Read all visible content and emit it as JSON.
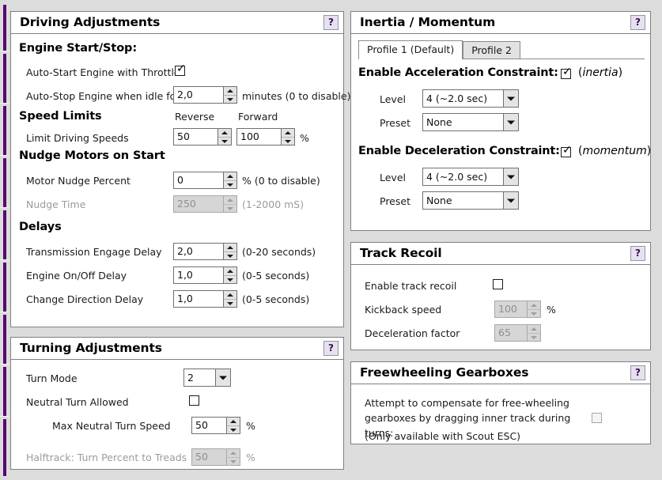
{
  "driving": {
    "title": "Driving Adjustments",
    "help": "?",
    "engine_section": "Engine Start/Stop:",
    "autostart_label": "Auto-Start Engine with Throttle",
    "autostart_checked": true,
    "autostop_label": "Auto-Stop Engine when idle for",
    "autostop_value": "2,0",
    "autostop_unit": "minutes (0 to disable)",
    "speed_section": "Speed Limits",
    "reverse_header": "Reverse",
    "forward_header": "Forward",
    "limit_label": "Limit Driving Speeds",
    "limit_reverse": "50",
    "limit_forward": "100",
    "limit_unit": "%",
    "nudge_section": "Nudge Motors on Start",
    "nudge_percent_label": "Motor Nudge Percent",
    "nudge_percent_value": "0",
    "nudge_percent_unit": "% (0 to disable)",
    "nudge_time_label": "Nudge Time",
    "nudge_time_value": "250",
    "nudge_time_unit": "(1-2000 mS)",
    "delays_section": "Delays",
    "transmission_label": "Transmission Engage Delay",
    "transmission_value": "2,0",
    "transmission_unit": "(0-20 seconds)",
    "engine_onoff_label": "Engine On/Off Delay",
    "engine_onoff_value": "1,0",
    "engine_onoff_unit": "(0-5 seconds)",
    "change_dir_label": "Change Direction Delay",
    "change_dir_value": "1,0",
    "change_dir_unit": "(0-5 seconds)"
  },
  "turning": {
    "title": "Turning Adjustments",
    "help": "?",
    "turn_mode_label": "Turn Mode",
    "turn_mode_value": "2",
    "neutral_turn_label": "Neutral Turn Allowed",
    "neutral_turn_checked": false,
    "max_neutral_label": "Max Neutral Turn Speed",
    "max_neutral_value": "50",
    "max_neutral_unit": "%",
    "halftrack_label": "Halftrack: Turn Percent to Treads",
    "halftrack_value": "50",
    "halftrack_unit": "%"
  },
  "inertia": {
    "title": "Inertia / Momentum",
    "help": "?",
    "tabs": [
      {
        "label": "Profile 1 (Default)",
        "active": true
      },
      {
        "label": "Profile 2",
        "active": false
      }
    ],
    "accel_label": "Enable Acceleration Constraint:",
    "accel_checked": true,
    "accel_note_open": "(",
    "accel_note": "inertia",
    "accel_note_close": ")",
    "accel_level_label": "Level",
    "accel_level_value": "4   (~2.0 sec)",
    "accel_preset_label": "Preset",
    "accel_preset_value": "None",
    "decel_label": "Enable Deceleration Constraint:",
    "decel_checked": true,
    "decel_note_open": "(",
    "decel_note": "momentum",
    "decel_note_close": ")",
    "decel_level_label": "Level",
    "decel_level_value": "4   (~2.0 sec)",
    "decel_preset_label": "Preset",
    "decel_preset_value": "None"
  },
  "recoil": {
    "title": "Track Recoil",
    "help": "?",
    "enable_label": "Enable track recoil",
    "enable_checked": false,
    "kickback_label": "Kickback speed",
    "kickback_value": "100",
    "kickback_unit": "%",
    "decel_factor_label": "Deceleration factor",
    "decel_factor_value": "65"
  },
  "freewheel": {
    "title": "Freewheeling Gearboxes",
    "help": "?",
    "line1": "Attempt to compensate for free-wheeling",
    "line2": "gearboxes by dragging inner track during turns:",
    "checked": false,
    "note": "(Only available with Scout ESC)"
  }
}
